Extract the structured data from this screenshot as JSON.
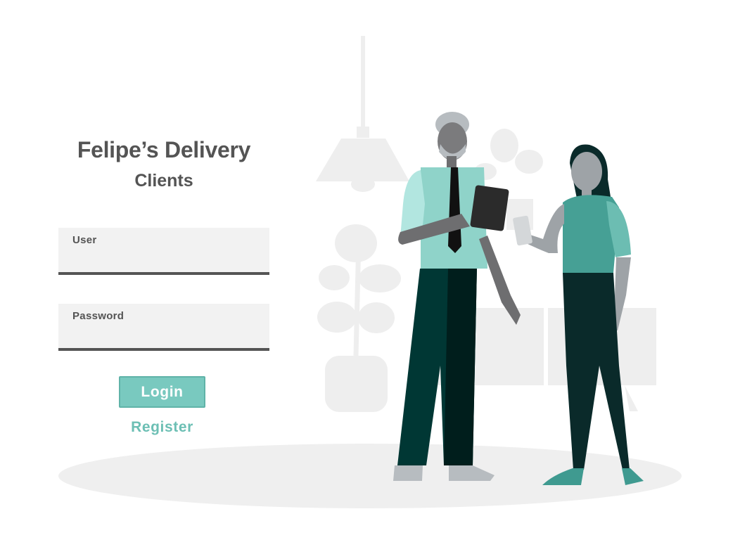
{
  "app": {
    "title": "Felipe’s Delivery",
    "subtitle": "Clients"
  },
  "form": {
    "user": {
      "label": "User",
      "value": "",
      "placeholder": ""
    },
    "password": {
      "label": "Password",
      "value": "",
      "placeholder": ""
    },
    "login_label": "Login",
    "register_label": "Register"
  },
  "colors": {
    "accent": "#79c9bf",
    "text_dark": "#545454",
    "field_bg": "#f2f2f2"
  },
  "illustration": {
    "icon": "two-people-office-illustration"
  }
}
